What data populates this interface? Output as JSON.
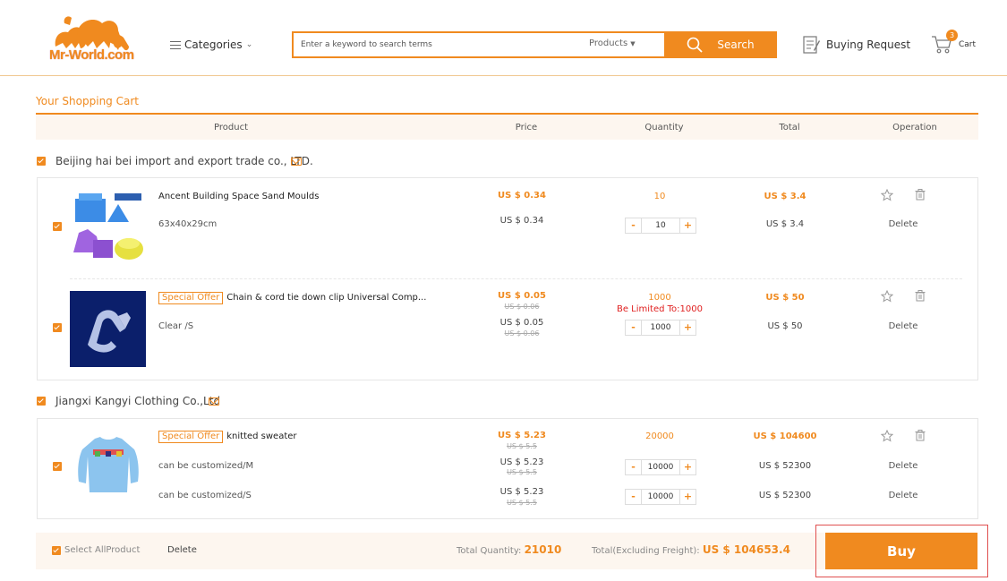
{
  "header": {
    "logo_text": "Mr-World.com",
    "categories_label": "Categories",
    "search": {
      "placeholder": "Enter a keyword to search terms",
      "category": "Products",
      "button_label": "Search"
    },
    "buying_request_label": "Buying Request",
    "cart": {
      "count": "3",
      "label": "Cart"
    }
  },
  "cart": {
    "title": "Your Shopping Cart",
    "columns": [
      "Product",
      "Price",
      "Quantity",
      "Total",
      "Operation"
    ],
    "sellers": [
      {
        "name": "Beijing hai bei import and export trade co., LTD.",
        "products": [
          {
            "name": "Ancent Building Space Sand Moulds",
            "badge": "",
            "unit_price": "US $ 0.34",
            "total_qty": "10",
            "total": "US $ 3.4",
            "limit": "",
            "variants": [
              {
                "spec": "63x40x29cm",
                "price": "US $ 0.34",
                "old_price": "",
                "qty": "10",
                "total": "US $ 3.4",
                "delete_label": "Delete"
              }
            ]
          },
          {
            "name": "Chain & cord tie down clip Universal Comp...",
            "badge": "Special Offer",
            "unit_price": "US $ 0.05",
            "unit_old_price": "US $ 0.06",
            "total_qty": "1000",
            "total": "US $ 50",
            "limit": "Be Limited To:1000",
            "variants": [
              {
                "spec": "Clear /S",
                "price": "US $ 0.05",
                "old_price": "US $ 0.06",
                "qty": "1000",
                "total": "US $ 50",
                "delete_label": "Delete"
              }
            ]
          }
        ]
      },
      {
        "name": "Jiangxi Kangyi Clothing Co.,Ltd",
        "products": [
          {
            "name": "knitted sweater",
            "badge": "Special Offer",
            "unit_price": "US $ 5.23",
            "unit_old_price": "US $ 5.5",
            "total_qty": "20000",
            "total": "US $ 104600",
            "limit": "",
            "variants": [
              {
                "spec": "can be customized/M",
                "price": "US $ 5.23",
                "old_price": "US $ 5.5",
                "qty": "10000",
                "total": "US $ 52300",
                "delete_label": "Delete"
              },
              {
                "spec": "can be customized/S",
                "price": "US $ 5.23",
                "old_price": "US $ 5.5",
                "qty": "10000",
                "total": "US $ 52300",
                "delete_label": "Delete"
              }
            ]
          }
        ]
      }
    ]
  },
  "footer": {
    "select_all_label": "Select AllProduct",
    "delete_label": "Delete",
    "total_quantity_label": "Total Quantity:",
    "total_quantity": "21010",
    "total_label": "Total(Excluding Freight):",
    "total_value": "US $ 104653.4",
    "buy_label": "Buy"
  },
  "colors": {
    "accent": "#f08a1f",
    "limit": "#e02020"
  }
}
